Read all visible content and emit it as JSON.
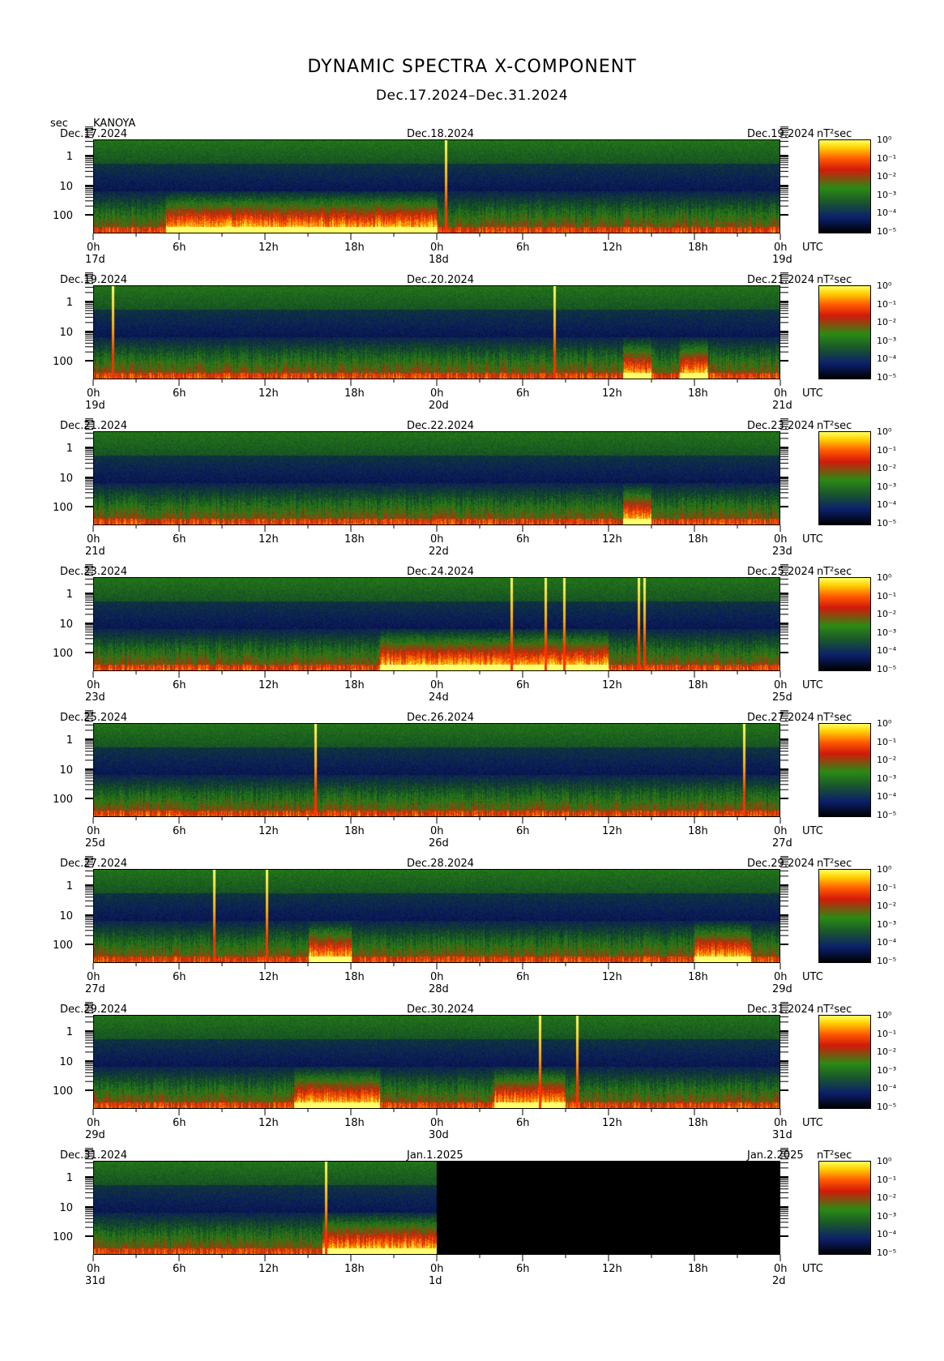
{
  "title": "DYNAMIC SPECTRA X-COMPONENT",
  "subtitle": "Dec.17.2024–Dec.31.2024",
  "y_unit": "sec",
  "station": "KANOYA",
  "colorbar_unit": "nT²sec",
  "colorbar_ticks": [
    "10⁰",
    "10⁻¹",
    "10⁻²",
    "10⁻³",
    "10⁻⁴",
    "10⁻⁵"
  ],
  "y_ticks": [
    "1",
    "10",
    "100"
  ],
  "x_ticks": [
    "0h",
    "6h",
    "12h",
    "18h",
    "0h",
    "6h",
    "12h",
    "18h",
    "0h"
  ],
  "x_unit": "UTC",
  "colors": {
    "low": "#000000",
    "mid": "#2a8a14",
    "high": "#ff1e00",
    "max": "#ffff60"
  },
  "panels": [
    {
      "date_left": "Dec.17.2024",
      "date_mid": "Dec.18.2024",
      "date_right": "Dec.19.2024",
      "day_start": "17d",
      "day_mid": "18d",
      "day_end": "19d",
      "spikes_h": [
        24.6
      ],
      "active_h": [
        [
          5,
          24
        ]
      ],
      "no_data_from_h": null
    },
    {
      "date_left": "Dec.19.2024",
      "date_mid": "Dec.20.2024",
      "date_right": "Dec.21.2024",
      "day_start": "19d",
      "day_mid": "20d",
      "day_end": "21d",
      "spikes_h": [
        1.3,
        32.2
      ],
      "active_h": [
        [
          37,
          39
        ],
        [
          41,
          43
        ]
      ],
      "no_data_from_h": null
    },
    {
      "date_left": "Dec.21.2024",
      "date_mid": "Dec.22.2024",
      "date_right": "Dec.23.2024",
      "day_start": "21d",
      "day_mid": "22d",
      "day_end": "23d",
      "spikes_h": [],
      "active_h": [
        [
          37,
          39
        ]
      ],
      "no_data_from_h": null
    },
    {
      "date_left": "Dec.23.2024",
      "date_mid": "Dec.24.2024",
      "date_right": "Dec.25.2024",
      "day_start": "23d",
      "day_mid": "24d",
      "day_end": "25d",
      "spikes_h": [
        29.2,
        31.6,
        32.9,
        38.1,
        38.5
      ],
      "active_h": [
        [
          20,
          36
        ]
      ],
      "no_data_from_h": null
    },
    {
      "date_left": "Dec.25.2024",
      "date_mid": "Dec.26.2024",
      "date_right": "Dec.27.2024",
      "day_start": "25d",
      "day_mid": "26d",
      "day_end": "27d",
      "spikes_h": [
        15.5,
        45.5
      ],
      "active_h": [],
      "no_data_from_h": null
    },
    {
      "date_left": "Dec.27.2024",
      "date_mid": "Dec.28.2024",
      "date_right": "Dec.29.2024",
      "day_start": "27d",
      "day_mid": "28d",
      "day_end": "29d",
      "spikes_h": [
        8.4,
        12.1
      ],
      "active_h": [
        [
          15,
          18
        ],
        [
          42,
          46
        ]
      ],
      "no_data_from_h": null
    },
    {
      "date_left": "Dec.29.2024",
      "date_mid": "Dec.30.2024",
      "date_right": "Dec.31.2024",
      "day_start": "29d",
      "day_mid": "30d",
      "day_end": "31d",
      "spikes_h": [
        31.2,
        33.8
      ],
      "active_h": [
        [
          14,
          20
        ],
        [
          28,
          33
        ]
      ],
      "no_data_from_h": null
    },
    {
      "date_left": "Dec.31.2024",
      "date_mid": "Jan.1.2025",
      "date_right": "Jan.2.2025",
      "day_start": "31d",
      "day_mid": "1d",
      "day_end": "2d",
      "spikes_h": [
        16.2
      ],
      "active_h": [
        [
          16,
          24
        ]
      ],
      "no_data_from_h": 24
    }
  ]
}
